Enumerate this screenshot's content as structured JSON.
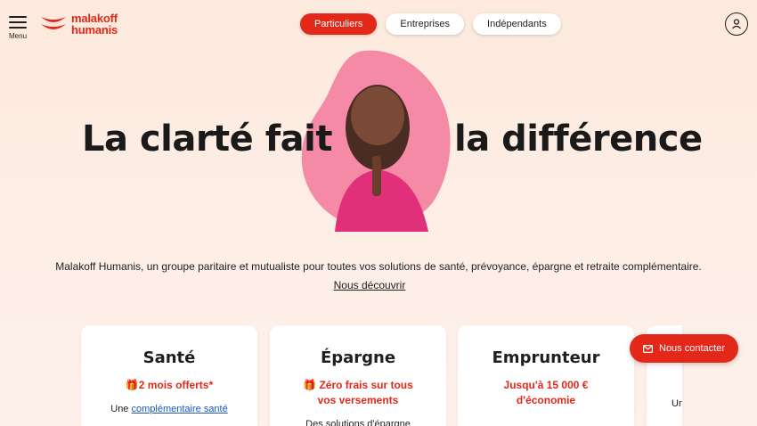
{
  "header": {
    "menu_label": "Menu",
    "logo_line1": "malakoff",
    "logo_line2": "humanis",
    "tabs": [
      {
        "label": "Particuliers",
        "active": true
      },
      {
        "label": "Entreprises",
        "active": false
      },
      {
        "label": "Indépendants",
        "active": false
      }
    ]
  },
  "hero": {
    "title_left": "La clarté fait",
    "title_right": "la différence"
  },
  "intro": {
    "tagline": "Malakoff Humanis, un groupe paritaire et mutualiste pour toutes vos solutions de santé, prévoyance, épargne et retraite complémentaire.",
    "discover_link": "Nous découvrir"
  },
  "cards": [
    {
      "title": "Santé",
      "offer": "🎁2 mois offerts*",
      "desc_prefix": "Une ",
      "desc_link": "complémentaire santé"
    },
    {
      "title": "Épargne",
      "offer": "🎁 Zéro frais sur tous vos versements",
      "desc_prefix": "Des solutions d'épargne",
      "desc_link": ""
    },
    {
      "title": "Emprunteur",
      "offer": "Jusqu'à 15 000 € d'économie",
      "desc_prefix": "",
      "desc_link": ""
    },
    {
      "title": "",
      "offer": "",
      "desc_prefix": "Un",
      "desc_link": ""
    }
  ],
  "contact": {
    "label": "Nous contacter"
  },
  "colors": {
    "brand_red": "#e3281a",
    "blob_pink": "#f58aa6",
    "background": "#fde9dd"
  },
  "icons": [
    "menu-icon",
    "logo-mark-icon",
    "account-icon",
    "mail-icon"
  ]
}
